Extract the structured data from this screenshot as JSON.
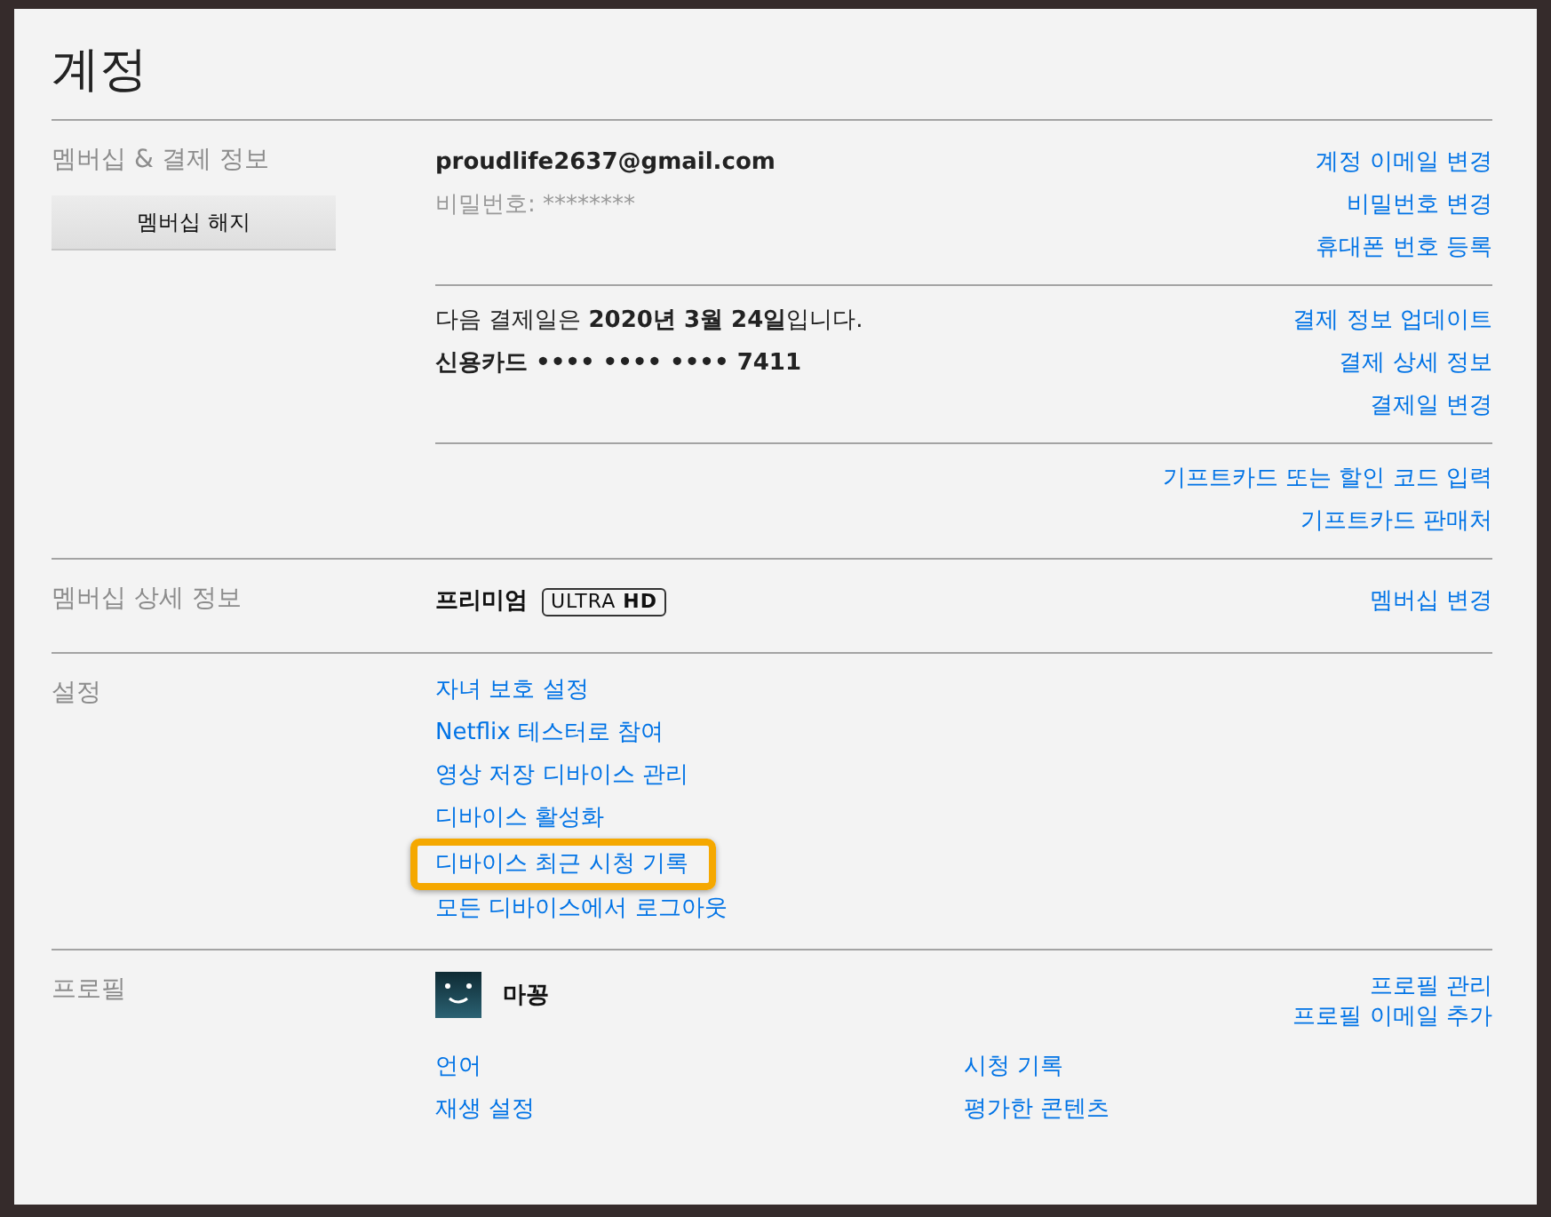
{
  "title": "계정",
  "membership": {
    "label": "멤버십 & 결제 정보",
    "cancel_button": "멤버십 해지",
    "groups": [
      {
        "lines": [
          {
            "text": "proudlife2637@gmail.com",
            "kind": "bold"
          },
          {
            "text": "비밀번호: ********",
            "kind": "muted"
          }
        ],
        "links": [
          "계정 이메일 변경",
          "비밀번호 변경",
          "휴대폰 번호 등록"
        ]
      },
      {
        "lines": [
          {
            "text": "다음 결제일은 **2020년 3월 24일**입니다.",
            "kind": "plain"
          },
          {
            "text": "신용카드 •••• •••• •••• 7411",
            "kind": "bold"
          }
        ],
        "links": [
          "결제 정보 업데이트",
          "결제 상세 정보",
          "결제일 변경"
        ]
      },
      {
        "links": [
          "기프트카드 또는 할인 코드 입력",
          "기프트카드 판매처"
        ]
      }
    ]
  },
  "plan": {
    "label": "멤버십 상세 정보",
    "name": "프리미엄",
    "badge": "ULTRA **HD**",
    "link": "멤버십 변경"
  },
  "settings": {
    "label": "설정",
    "links": [
      {
        "text": "자녀 보호 설정",
        "highlighted": false
      },
      {
        "text": "Netflix 테스터로 참여",
        "highlighted": false
      },
      {
        "text": "영상 저장 디바이스 관리",
        "highlighted": false
      },
      {
        "text": "디바이스 활성화",
        "highlighted": false
      },
      {
        "text": "디바이스 최근 시청 기록",
        "highlighted": true
      },
      {
        "text": "모든 디바이스에서 로그아웃",
        "highlighted": false
      }
    ]
  },
  "profile": {
    "label": "프로필",
    "name": "마꽁",
    "links": [
      "프로필 관리",
      "프로필 이메일 추가"
    ],
    "options": [
      "언어",
      "시청 기록",
      "재생 설정",
      "평가한 콘텐츠"
    ]
  }
}
